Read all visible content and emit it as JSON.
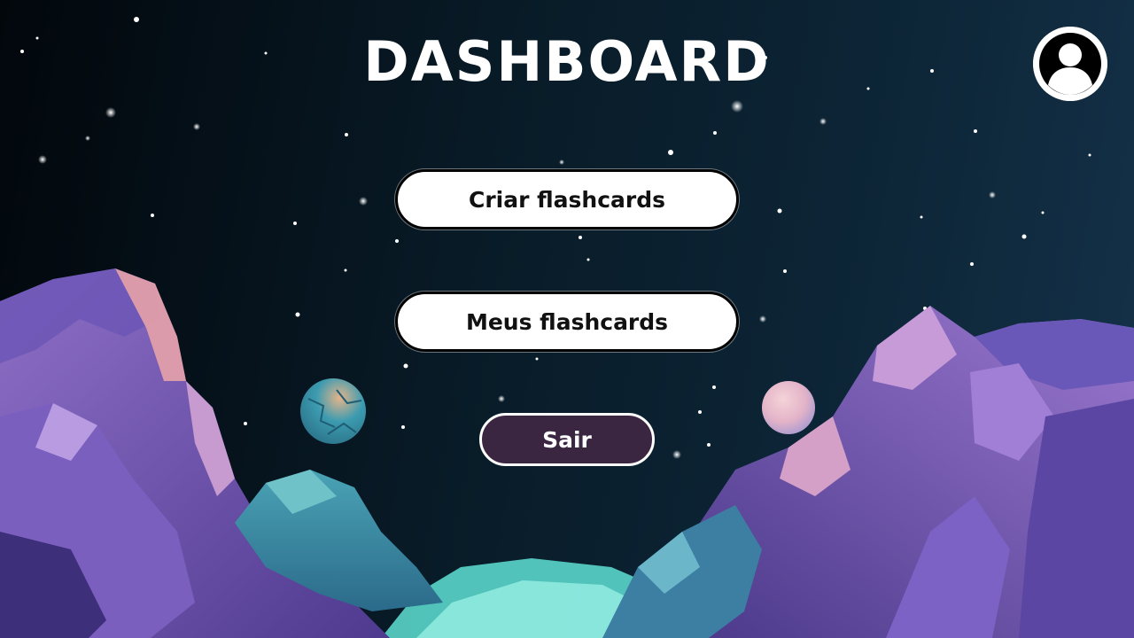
{
  "page": {
    "title": "DASHBOARD"
  },
  "header": {
    "profile_icon": "user-icon"
  },
  "menu": {
    "create_label": "Criar flashcards",
    "mine_label": "Meus flashcards",
    "exit_label": "Sair"
  },
  "colors": {
    "background": "#0a1a26",
    "button_bg": "#ffffff",
    "button_border": "#000000",
    "exit_bg": "#3a2640",
    "exit_border": "#ffffff",
    "title": "#ffffff"
  }
}
